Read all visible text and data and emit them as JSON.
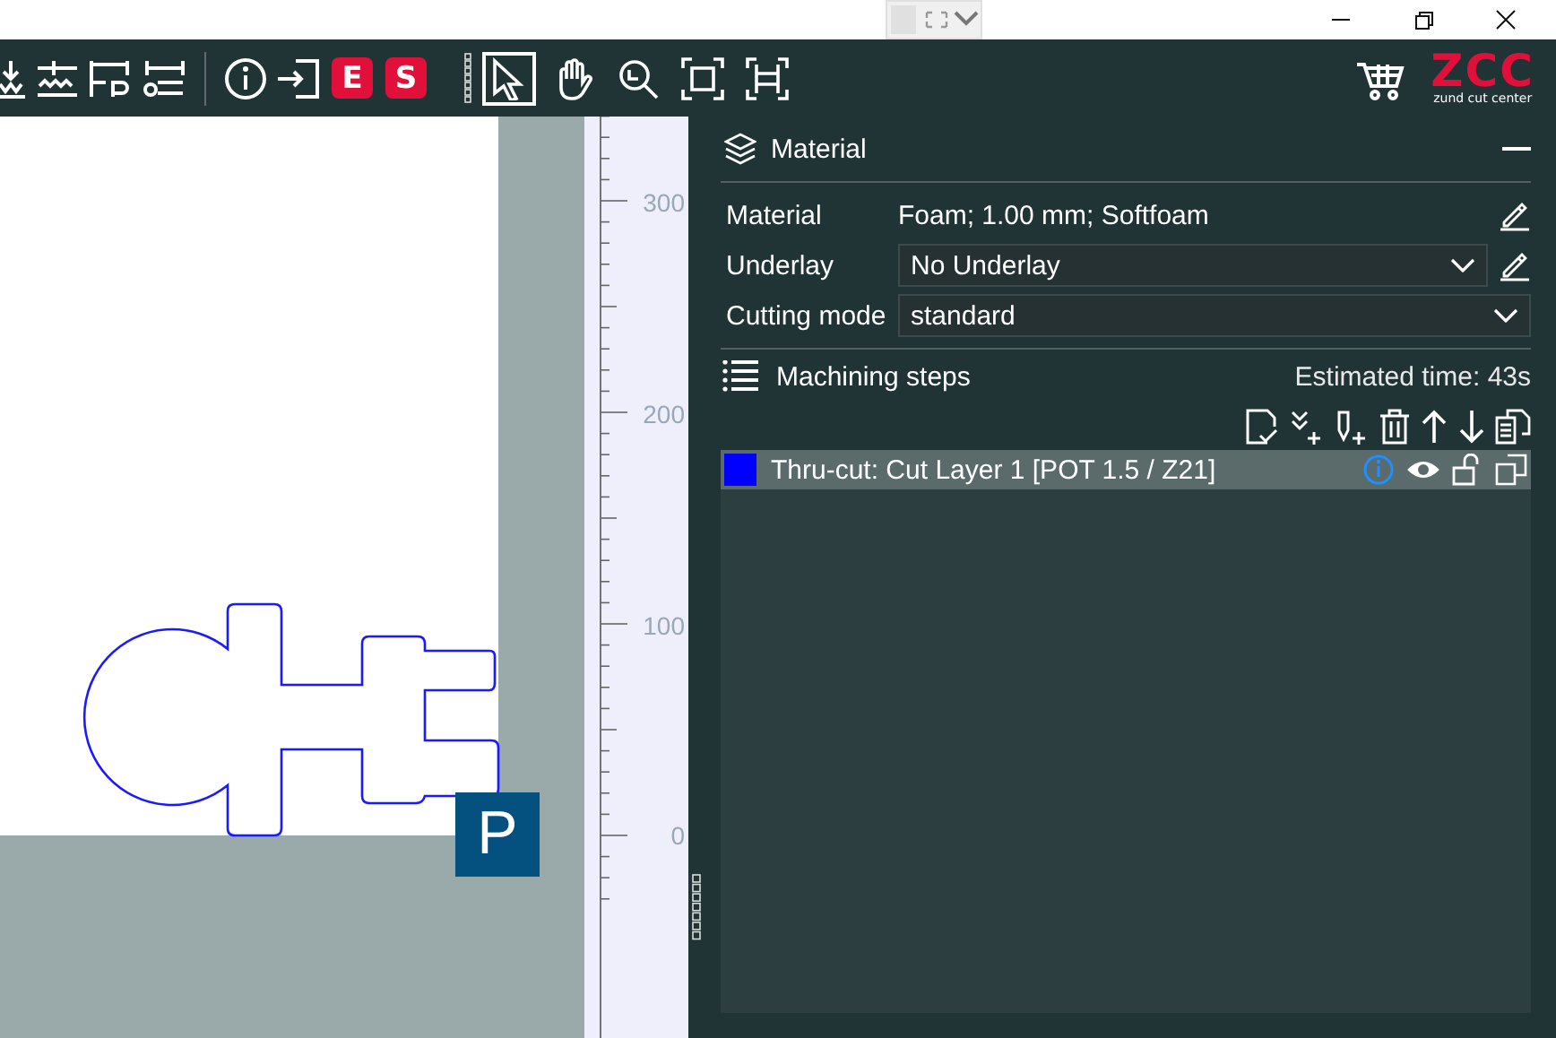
{
  "toolbar": {
    "job_buttons": [
      "E",
      "S"
    ],
    "view_tools": [
      {
        "selected": true
      },
      {
        "selected": false
      },
      {
        "selected": false
      },
      {
        "selected": false
      },
      {
        "selected": false
      }
    ],
    "logo": {
      "mark": "ZCC",
      "caption": "zund cut center"
    }
  },
  "canvas": {
    "marker": "P",
    "ruler_labels": [
      "300",
      "200",
      "100",
      "0"
    ]
  },
  "material_panel": {
    "title": "Material",
    "fields": [
      {
        "label": "Material",
        "value": "Foam; 1.00 mm; Softfoam",
        "kind": "text",
        "editable": true
      },
      {
        "label": "Underlay",
        "value": "No Underlay",
        "kind": "dropdown",
        "editable": true
      },
      {
        "label": "Cutting mode",
        "value": "standard",
        "kind": "dropdown",
        "editable": false
      }
    ]
  },
  "machining_steps": {
    "title": "Machining steps",
    "estimated_time": "Estimated time: 43s",
    "steps": [
      {
        "label": "Thru-cut: Cut Layer 1 [POT 1.5 / Z21]",
        "color": "#0000ff",
        "selected": true
      }
    ]
  }
}
